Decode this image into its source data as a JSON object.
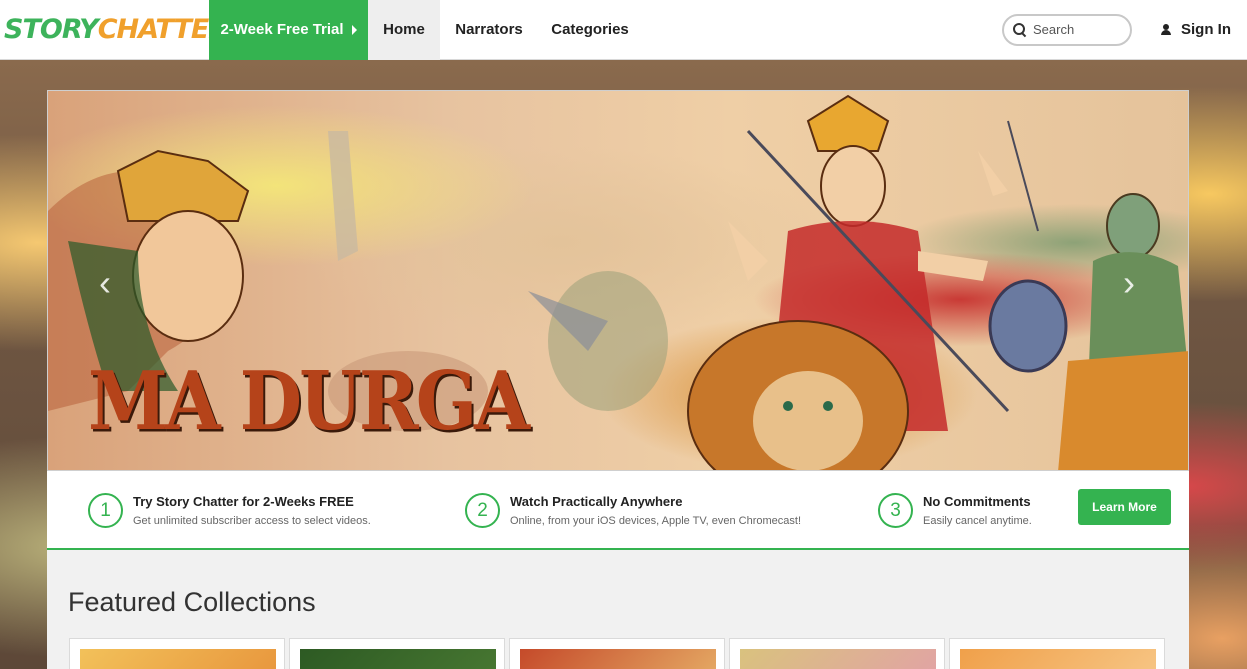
{
  "header": {
    "logo_part1": "STORY",
    "logo_part2": "CHATTER",
    "trial_label": "2-Week Free Trial",
    "nav": [
      {
        "label": "Home"
      },
      {
        "label": "Narrators"
      },
      {
        "label": "Categories"
      }
    ],
    "search_placeholder": "Search",
    "signin_label": "Sign In"
  },
  "hero": {
    "title": "MA DURGA",
    "prev_glyph": "‹",
    "next_glyph": "›"
  },
  "steps": [
    {
      "num": "1",
      "title": "Try Story Chatter for 2-Weeks FREE",
      "sub": "Get unlimited subscriber access to select videos."
    },
    {
      "num": "2",
      "title": "Watch Practically Anywhere",
      "sub": "Online, from your iOS devices, Apple TV, even Chromecast!"
    },
    {
      "num": "3",
      "title": "No Commitments",
      "sub": "Easily cancel anytime."
    }
  ],
  "learn_more_label": "Learn More",
  "featured": {
    "title": "Featured Collections",
    "thumb_colors": [
      [
        "#f2c15a",
        "#e7923a"
      ],
      [
        "#2d5a23",
        "#4a7a33"
      ],
      [
        "#c54a2a",
        "#e8b36a"
      ],
      [
        "#d9c27e",
        "#e2a0a8"
      ],
      [
        "#f0a04a",
        "#f7c98a"
      ]
    ]
  },
  "colors": {
    "accent": "#34b350",
    "logo_orange": "#f0a02c"
  }
}
